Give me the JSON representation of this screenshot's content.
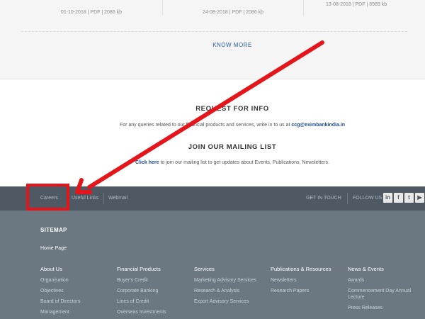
{
  "documents": {
    "items": [
      {
        "meta": "01-10-2018 | PDF | 2086 kb"
      },
      {
        "meta": "24-08-2018 | PDF | 2086 kb"
      },
      {
        "meta": "13-08-2018 | PDF | 8989 kb"
      }
    ],
    "know_more": "KNOW MORE"
  },
  "request_info": {
    "title": "REQUEST FOR INFO",
    "text": "For any queries related to our financial products and services, write in to us at ",
    "email": "ccg@eximbankindia.in"
  },
  "mailing": {
    "title": "JOIN OUR MAILING LIST",
    "link": "Click here",
    "text": " to join our mailing list to get updates about Events, Publications, Newsletters."
  },
  "topbar": {
    "links": [
      "Careers",
      "Useful Links",
      "Webmail"
    ],
    "get_in_touch": "GET IN TOUCH",
    "follow_us": "FOLLOW US",
    "social_icons": [
      "linkedin-icon",
      "facebook-icon",
      "twitter-icon",
      "youtube-icon"
    ]
  },
  "footer": {
    "sitemap": "SITEMAP",
    "home": "Home Page",
    "columns": [
      {
        "heading": "About Us",
        "items": [
          "Organisation",
          "Objectives",
          "Board of Directors",
          "Management"
        ]
      },
      {
        "heading": "Financial Products",
        "items": [
          "Buyer's Credit",
          "Corporate Banking",
          "Lines of Credit",
          "Overseas Investments"
        ]
      },
      {
        "heading": "Services",
        "items": [
          "Marketing Advisory Services",
          "Research & Analysis",
          "Export Advisory Services"
        ]
      },
      {
        "heading": "Publications & Resources",
        "items": [
          "Newsletters",
          "Research Papers"
        ]
      },
      {
        "heading": "News & Events",
        "items": [
          "Awards",
          "Commencement Day Annual Lecture",
          "Press Releases"
        ]
      }
    ]
  },
  "colors": {
    "annotation": "#e4161b",
    "footer_bar": "#4f5963",
    "footer_bg": "#6b7882",
    "link_blue": "#2b5b9b"
  }
}
